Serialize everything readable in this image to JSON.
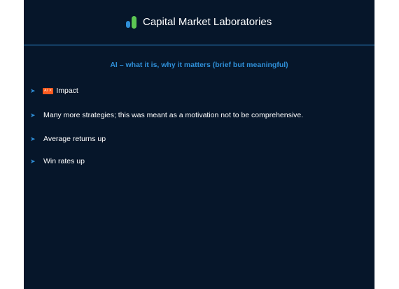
{
  "header": {
    "brand": "Capital Market Laboratories",
    "logo_icon": "capital-market-laboratories-logo"
  },
  "slide": {
    "subtitle": "AI – what it is, why it matters (brief but meaningful)",
    "bullets": [
      {
        "badge": "AI ✕",
        "text": "Impact"
      },
      {
        "text": "Many  more strategies; this was meant as a motivation not to be comprehensive."
      },
      {
        "text": "Average returns up"
      },
      {
        "text": "Win rates up"
      }
    ]
  },
  "colors": {
    "background": "#06162a",
    "accent": "#2f8fd8",
    "text": "#ffffff",
    "badge": "#ff5a1f"
  }
}
